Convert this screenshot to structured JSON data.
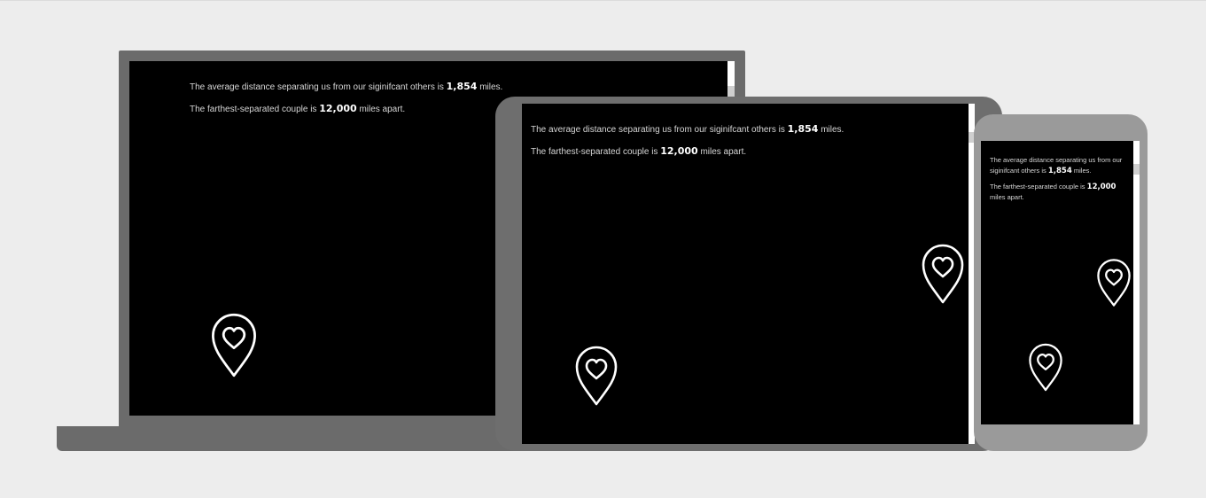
{
  "stats": {
    "average": {
      "prefix": "The average distance separating us from our siginifcant others is",
      "value": "1,854",
      "suffix": "miles."
    },
    "farthest": {
      "prefix": "The farthest-separated couple is",
      "value": "12,000",
      "suffix": "miles apart."
    }
  },
  "icons": {
    "pin": "heart-map-pin-icon"
  },
  "colors": {
    "page_background": "#ededed",
    "laptop_frame": "#6b6b6b",
    "tablet_frame": "#6e6e6e",
    "phone_frame": "#9a9a9a",
    "screen_background": "#000000",
    "text": "#d6d6d6",
    "highlight": "#ffffff"
  }
}
